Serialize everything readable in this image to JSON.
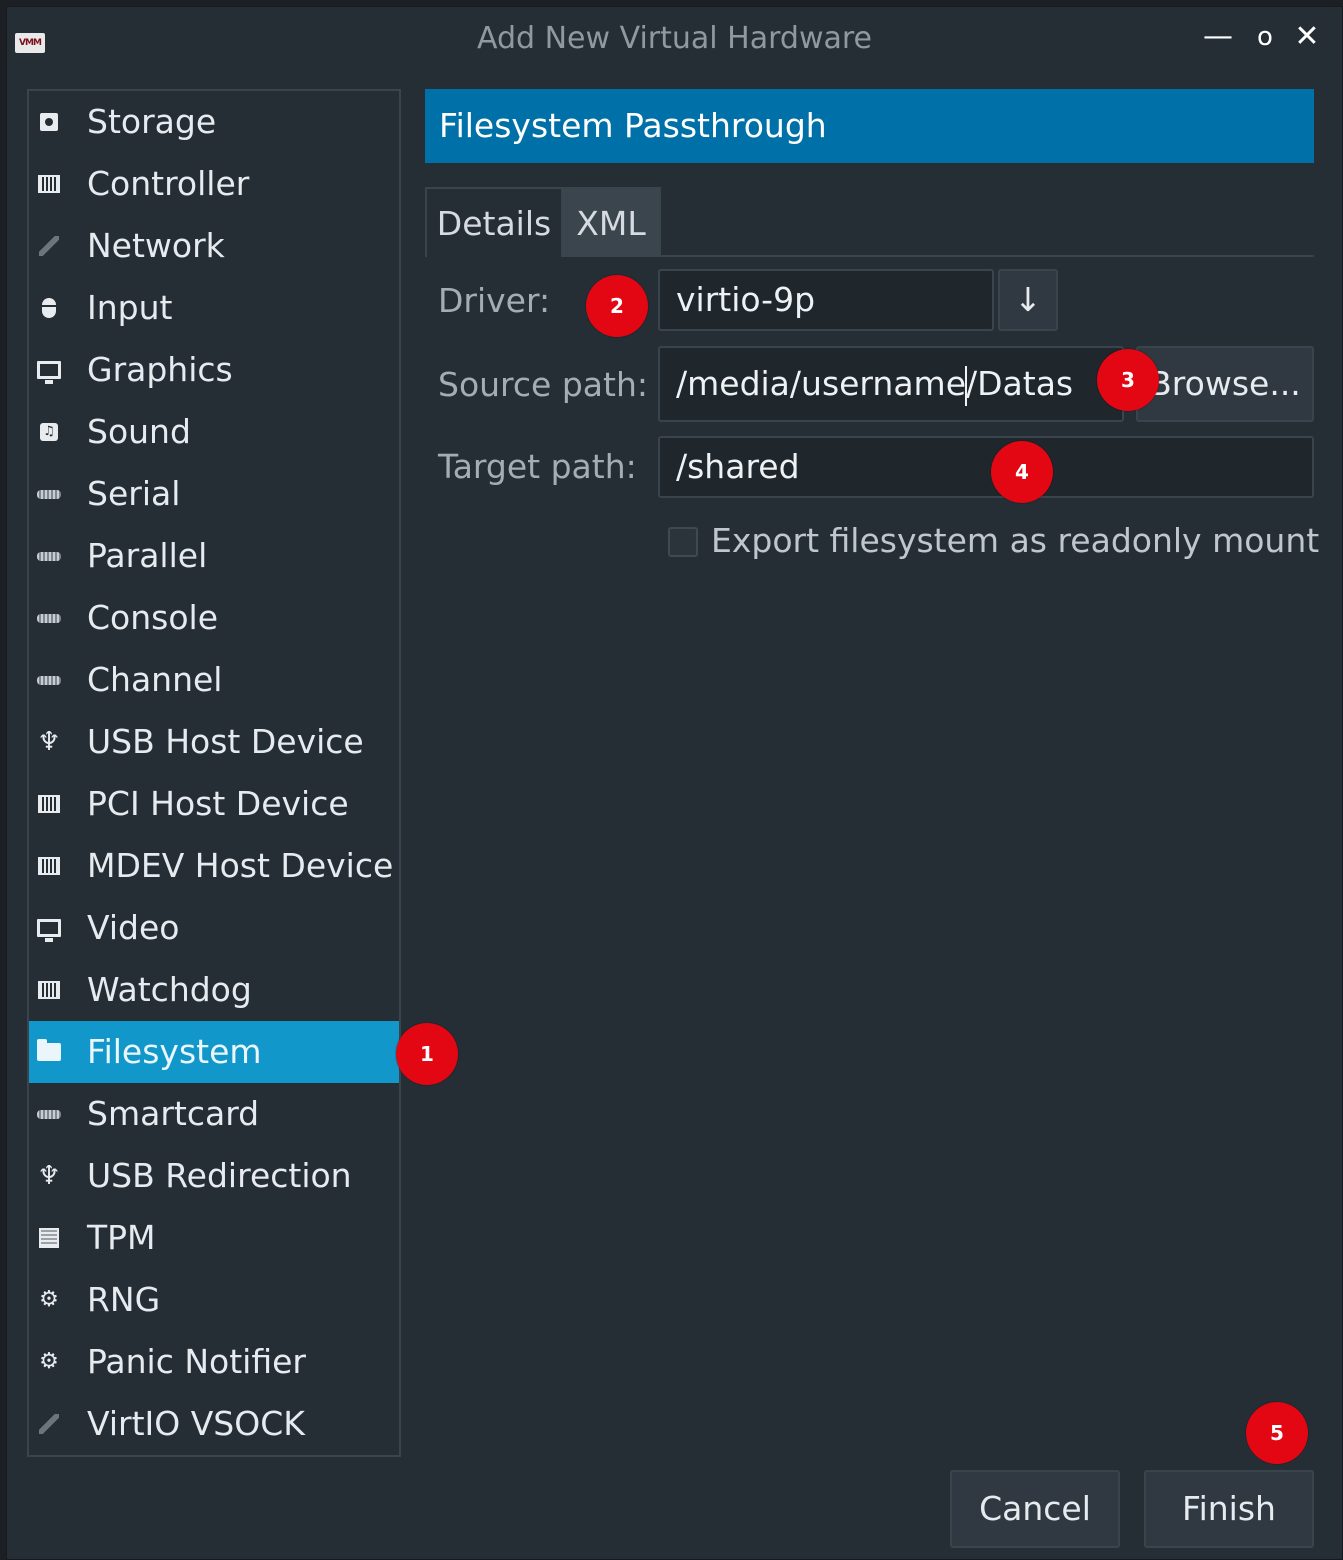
{
  "window": {
    "app_icon_text": "VMM",
    "title": "Add New Virtual Hardware",
    "controls": {
      "minimize": "—",
      "maximize": "o",
      "close": "✕"
    }
  },
  "sidebar": {
    "items": [
      {
        "label": "Storage",
        "icon": "storage-icon"
      },
      {
        "label": "Controller",
        "icon": "controller-icon"
      },
      {
        "label": "Network",
        "icon": "network-icon"
      },
      {
        "label": "Input",
        "icon": "mouse-icon"
      },
      {
        "label": "Graphics",
        "icon": "monitor-icon"
      },
      {
        "label": "Sound",
        "icon": "sound-icon"
      },
      {
        "label": "Serial",
        "icon": "serial-port-icon"
      },
      {
        "label": "Parallel",
        "icon": "parallel-port-icon"
      },
      {
        "label": "Console",
        "icon": "console-port-icon"
      },
      {
        "label": "Channel",
        "icon": "channel-port-icon"
      },
      {
        "label": "USB Host Device",
        "icon": "usb-icon"
      },
      {
        "label": "PCI Host Device",
        "icon": "pci-card-icon"
      },
      {
        "label": "MDEV Host Device",
        "icon": "mdev-card-icon"
      },
      {
        "label": "Video",
        "icon": "monitor-icon"
      },
      {
        "label": "Watchdog",
        "icon": "watchdog-card-icon"
      },
      {
        "label": "Filesystem",
        "icon": "folder-icon",
        "selected": true
      },
      {
        "label": "Smartcard",
        "icon": "smartcard-port-icon"
      },
      {
        "label": "USB Redirection",
        "icon": "usb-icon"
      },
      {
        "label": "TPM",
        "icon": "chip-icon"
      },
      {
        "label": "RNG",
        "icon": "gear-icon"
      },
      {
        "label": "Panic Notifier",
        "icon": "gear-icon"
      },
      {
        "label": "VirtIO VSOCK",
        "icon": "network-icon"
      }
    ]
  },
  "panel": {
    "header": "Filesystem Passthrough",
    "tabs": [
      {
        "label": "Details",
        "active": true
      },
      {
        "label": "XML",
        "active": false
      }
    ],
    "driver": {
      "label": "Driver:",
      "value": "virtio-9p",
      "dropdown_glyph": "↓"
    },
    "source": {
      "label": "Source path:",
      "value_before_caret": "/media/username",
      "value_after_caret": "/Datas",
      "browse_label": "Browse..."
    },
    "target": {
      "label": "Target path:",
      "value": "/shared"
    },
    "readonly": {
      "label": "Export filesystem as readonly mount",
      "checked": false
    }
  },
  "footer": {
    "cancel_label": "Cancel",
    "finish_label": "Finish"
  },
  "annotations": [
    "1",
    "2",
    "3",
    "4",
    "5"
  ],
  "colors": {
    "accent": "#1197c9",
    "header": "#0070a8",
    "badge": "#e30613",
    "background": "#262e35"
  }
}
